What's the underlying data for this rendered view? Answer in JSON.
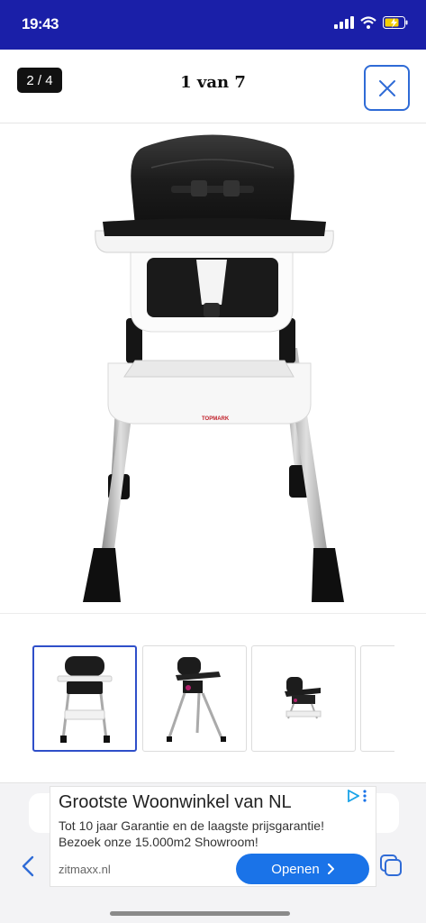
{
  "status_bar": {
    "time": "19:43",
    "background": "#1a1fa8"
  },
  "header": {
    "counter": "2 / 4",
    "title": "1 van 7",
    "accent": "#2f6bd6"
  },
  "product": {
    "brand_print": "TOPMARK"
  },
  "thumbnails": [
    {
      "name": "thumb-front",
      "active": true
    },
    {
      "name": "thumb-angle",
      "active": false
    },
    {
      "name": "thumb-side",
      "active": false
    },
    {
      "name": "thumb-partial",
      "active": false
    }
  ],
  "ad": {
    "title": "Grootste Woonwinkel van NL",
    "description": "Tot 10 jaar Garantie en de laagste prijsgarantie! Bezoek onze 15.000m2 Showroom!",
    "domain": "zitmaxx.nl",
    "cta": "Openen",
    "cta_color": "#1a73e8"
  },
  "icons": {
    "close": "close-icon",
    "back": "chevron-left-icon",
    "tabs": "tabs-icon",
    "cta_arrow": "chevron-right-icon",
    "adchoices": "adchoices-icon"
  }
}
